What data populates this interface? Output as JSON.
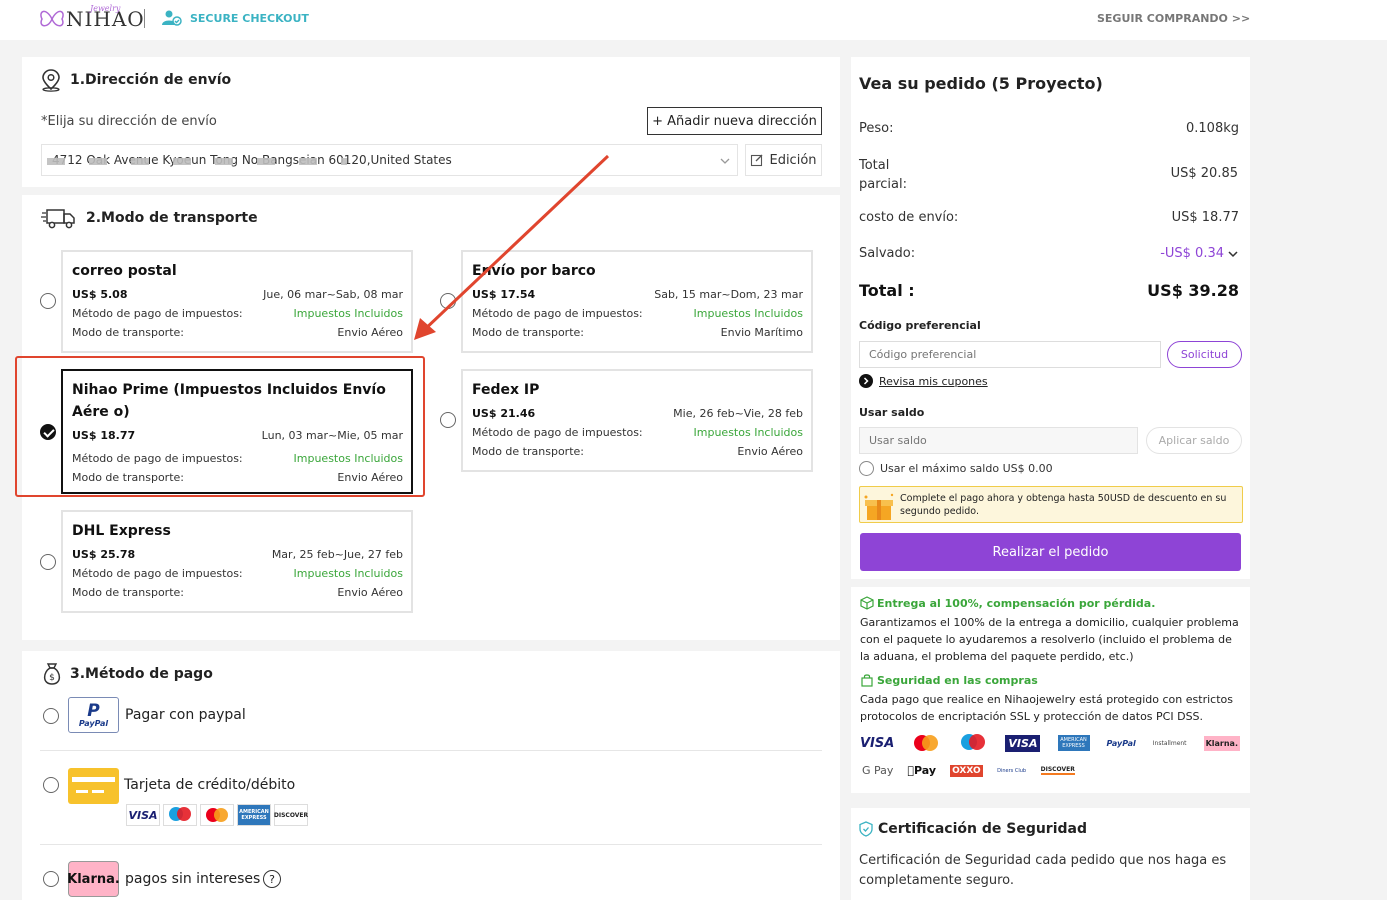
{
  "header": {
    "logo_text": "NIHAO",
    "logo_sub": "Jewelry",
    "secure_label": "SECURE CHECKOUT",
    "keep_shopping": "SEGUIR COMPRANDO >>"
  },
  "address": {
    "title": "1.Dirección de envío",
    "choose_label": "*Elija su dirección de envío",
    "add_button": "+ Añadir nueva dirección",
    "selected_address": "4712 Oak Avenue Kyoeun Tong No Bangseian 60120,United States",
    "edit_button": "Edición"
  },
  "shipping": {
    "title": "2.Modo de transporte",
    "tax_label": "Método de pago de impuestos:",
    "mode_label": "Modo de transporte:",
    "options": [
      {
        "name": "correo postal",
        "price": "US$ 5.08",
        "dates": "Jue, 06 mar~Sab, 08 mar",
        "tax": "Impuestos Incluidos",
        "mode": "Envio Aéreo",
        "selected": false
      },
      {
        "name": "Envío por barco",
        "price": "US$ 17.54",
        "dates": "Sab, 15 mar~Dom, 23 mar",
        "tax": "Impuestos Incluidos",
        "mode": "Envio Marítimo",
        "selected": false
      },
      {
        "name": "Nihao Prime (Impuestos Incluidos Envío Aére o)",
        "price": "US$ 18.77",
        "dates": "Lun, 03 mar~Mie, 05 mar",
        "tax": "Impuestos Incluidos",
        "mode": "Envio Aéreo",
        "selected": true
      },
      {
        "name": "Fedex IP",
        "price": "US$ 21.46",
        "dates": "Mie, 26 feb~Vie, 28 feb",
        "tax": "Impuestos Incluidos",
        "mode": "Envio Aéreo",
        "selected": false
      },
      {
        "name": "DHL Express",
        "price": "US$ 25.78",
        "dates": "Mar, 25 feb~Jue, 27 feb",
        "tax": "Impuestos Incluidos",
        "mode": "Envio Aéreo",
        "selected": false
      }
    ]
  },
  "payment": {
    "title": "3.Método de pago",
    "paypal_label": "Pagar con paypal",
    "paypal_logo": "PayPal",
    "card_label": "Tarjeta de crédito/débito",
    "card_logos": [
      "VISA",
      "maestro",
      "mastercard",
      "AMERICAN EXPRESS",
      "DISCOVER"
    ],
    "klarna_label": "pagos sin intereses",
    "klarna_logo": "Klarna.",
    "help_icon": "?"
  },
  "summary": {
    "title": "Vea su pedido (5 Proyecto)",
    "weight_label": "Peso:",
    "weight_value": "0.108kg",
    "subtotal_label_1": "Total",
    "subtotal_label_2": "parcial:",
    "subtotal_value": "US$ 20.85",
    "shipping_label": "costo de envío:",
    "shipping_value": "US$ 18.77",
    "saved_label": "Salvado:",
    "saved_value": "-US$ 0.34",
    "total_label": "Total :",
    "total_value": "US$ 39.28",
    "coupon_title": "Código preferencial",
    "coupon_placeholder": "Código preferencial",
    "coupon_button": "Solicitud",
    "coupon_link": "Revisa mis cupones",
    "balance_title": "Usar saldo",
    "balance_placeholder": "Usar saldo",
    "balance_button": "Aplicar saldo",
    "balance_max": "Usar el máximo saldo US$ 0.00",
    "promo_text": "Complete el pago ahora y obtenga hasta 50USD de descuento en su segundo pedido.",
    "place_order": "Realizar el pedido"
  },
  "guarantee": {
    "delivery_title": "Entrega al 100%, compensación por pérdida.",
    "delivery_text": "Garantizamos el 100% de la entrega a domicilio, cualquier problema con el paquete lo ayudaremos a resolverlo (incluido el problema de la aduana, el problema del paquete perdido, etc.)",
    "security_title": "Seguridad en las compras",
    "security_text": "Cada pago que realice en Nihaojewelry está protegido con estrictos protocolos de encriptación SSL y protección de datos PCI DSS.",
    "logos_row1": [
      "VISA",
      "mastercard",
      "maestro",
      "VISA",
      "AMERICAN EXPRESS",
      "PayPal",
      "Installment",
      "Klarna."
    ],
    "logos_row2": [
      "G Pay",
      "Pay",
      "OXXO",
      "Diners Club",
      "DISCOVER"
    ]
  },
  "certification": {
    "title": "Certificación de Seguridad",
    "text": "Certificación de Seguridad cada pedido que nos haga es completamente seguro."
  },
  "colors": {
    "accent_purple": "#8e44d6",
    "teal": "#3bb3c3",
    "green": "#3aa63a",
    "highlight_red": "#e0452e"
  }
}
